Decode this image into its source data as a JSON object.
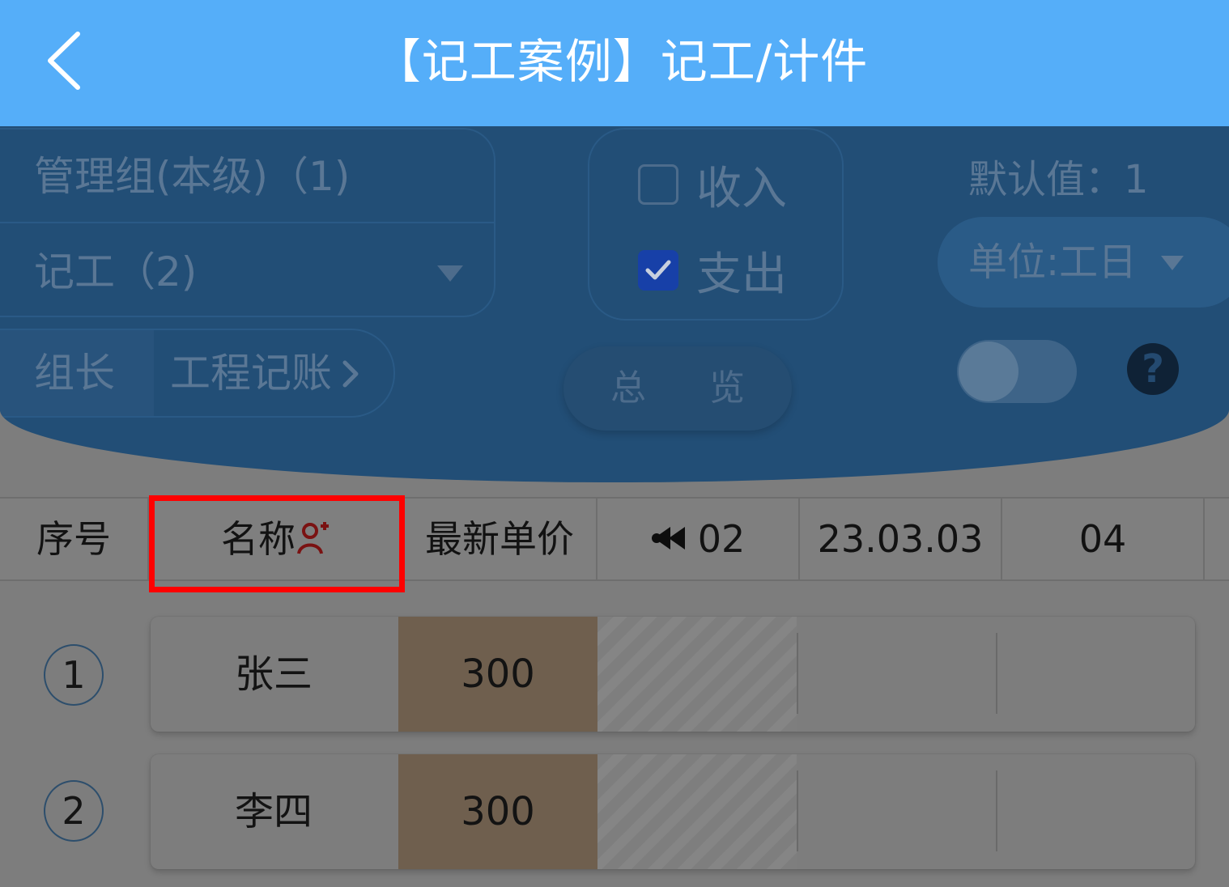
{
  "header": {
    "title": "【记工案例】记工/计件"
  },
  "panel": {
    "group_name": "管理组(本级)（1)",
    "record_type": "记工（2)",
    "leader_label": "组长",
    "leader_link": "工程记账",
    "income_label": "收入",
    "expense_label": "支出",
    "income_checked": false,
    "expense_checked": true,
    "overview_label": "总 览",
    "default_value": "默认值：1",
    "unit": "单位:工日",
    "toggle_on": false
  },
  "table": {
    "headers": [
      "序号",
      "名称",
      "最新单价",
      "02",
      "23.03.03",
      "04"
    ],
    "rows": [
      {
        "index": "1",
        "name": "张三",
        "price": "300"
      },
      {
        "index": "2",
        "name": "李四",
        "price": "300"
      }
    ]
  },
  "colors": {
    "appbar": "#55aef9",
    "highlight": "#ff0000",
    "expense_checkbox": "#1740a8"
  }
}
